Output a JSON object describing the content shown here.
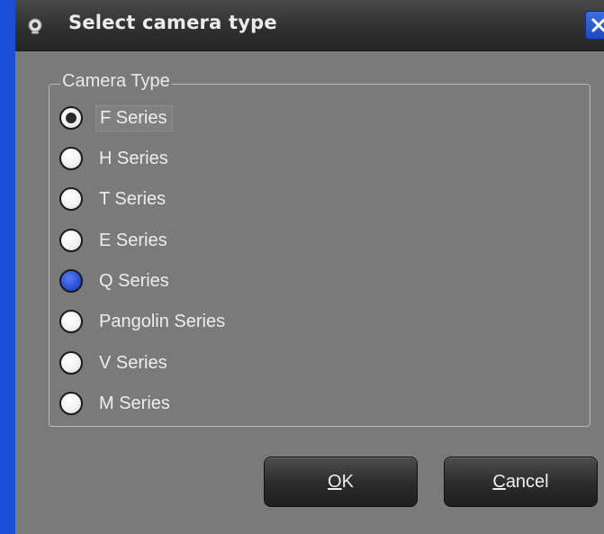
{
  "window": {
    "title": "Select camera type"
  },
  "group": {
    "legend": "Camera Type",
    "options": [
      {
        "label": "F Series",
        "state": "checked"
      },
      {
        "label": "H Series",
        "state": "unchecked"
      },
      {
        "label": "T Series",
        "state": "unchecked"
      },
      {
        "label": "E Series",
        "state": "unchecked"
      },
      {
        "label": "Q Series",
        "state": "hover"
      },
      {
        "label": "Pangolin Series",
        "state": "unchecked"
      },
      {
        "label": "V Series",
        "state": "unchecked"
      },
      {
        "label": "M Series",
        "state": "unchecked"
      }
    ],
    "selected": "F Series"
  },
  "buttons": {
    "ok": {
      "mnemonic": "O",
      "rest": "K"
    },
    "cancel": {
      "mnemonic": "C",
      "rest": "ancel"
    }
  },
  "colors": {
    "dialog_bg": "#7a7a7a",
    "titlebar": "#2e2e2e",
    "accent_blue": "#1a4fd6",
    "hover_radio": "#2a4fd8"
  },
  "icons": {
    "app": "webcam-icon",
    "close": "close-icon"
  }
}
